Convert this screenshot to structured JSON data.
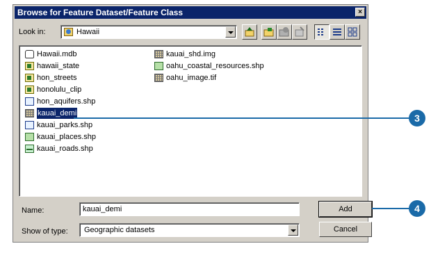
{
  "dialog": {
    "title": "Browse for Feature Dataset/Feature Class",
    "close_label": "×"
  },
  "look_in": {
    "label": "Look in:",
    "value": "Hawaii",
    "icon": "globe-folder-icon"
  },
  "toolbar": {
    "buttons": [
      "up-one-level-icon",
      "connect-folder-icon",
      "disconnect-folder-icon",
      "properties-icon",
      "list-view-icon",
      "details-view-icon",
      "thumbnails-view-icon"
    ]
  },
  "files": [
    {
      "name": "Hawaii.mdb",
      "icon": "database-icon"
    },
    {
      "name": "hawaii_state",
      "icon": "coverage-icon"
    },
    {
      "name": "hon_streets",
      "icon": "coverage-icon"
    },
    {
      "name": "honolulu_clip",
      "icon": "coverage-icon"
    },
    {
      "name": "hon_aquifers.shp",
      "icon": "polygon-shapefile-icon"
    },
    {
      "name": "kauai_demi",
      "icon": "raster-icon",
      "selected": true
    },
    {
      "name": "kauai_parks.shp",
      "icon": "polygon-shapefile-icon"
    },
    {
      "name": "kauai_places.shp",
      "icon": "point-shapefile-icon"
    },
    {
      "name": "kauai_roads.shp",
      "icon": "line-shapefile-icon"
    },
    {
      "name": "kauai_shd.img",
      "icon": "raster-icon"
    },
    {
      "name": "oahu_coastal_resources.shp",
      "icon": "point-shapefile-icon"
    },
    {
      "name": "oahu_image.tif",
      "icon": "raster-icon"
    }
  ],
  "name_field": {
    "label": "Name:",
    "value": "kauai_demi"
  },
  "type_field": {
    "label": "Show of type:",
    "value": "Geographic datasets"
  },
  "buttons": {
    "add": "Add",
    "cancel": "Cancel"
  },
  "callouts": {
    "step3": "3",
    "step4": "4",
    "color": "#1a6aa8"
  }
}
